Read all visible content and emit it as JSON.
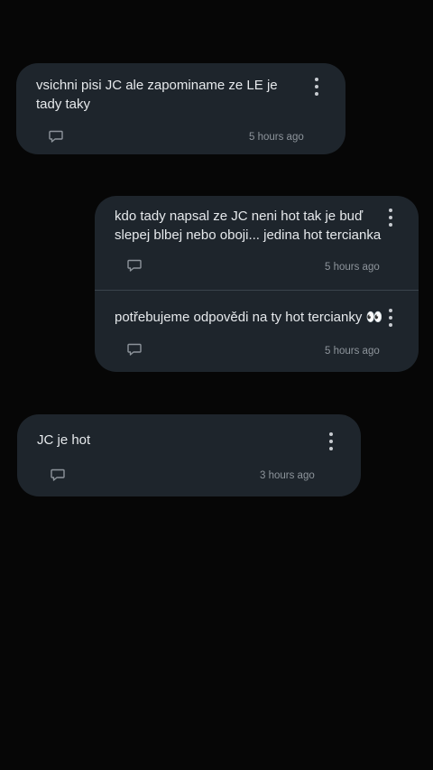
{
  "messages": [
    {
      "text": "vsichni pisi JC ale zapominame ze LE je tady taky",
      "time": "5 hours ago",
      "comment_icon": "comment-bubble-icon",
      "more_icon": "more-vertical-icon"
    },
    {
      "text": "kdo tady napsal ze JC neni hot tak je buď slepej blbej nebo oboji... jedina hot tercianka",
      "time": "5 hours ago",
      "comment_icon": "comment-bubble-icon",
      "more_icon": "more-vertical-icon"
    },
    {
      "text": "potřebujeme odpovědi na ty hot tercianky 👀",
      "time": "5 hours ago",
      "comment_icon": "comment-bubble-icon",
      "more_icon": "more-vertical-icon"
    },
    {
      "text": "JC je hot",
      "time": "3 hours ago",
      "comment_icon": "comment-bubble-icon",
      "more_icon": "more-vertical-icon"
    }
  ],
  "colors": {
    "background": "#060606",
    "card": "#1e252c",
    "text": "#e6e9ec",
    "meta": "#8d949b"
  }
}
